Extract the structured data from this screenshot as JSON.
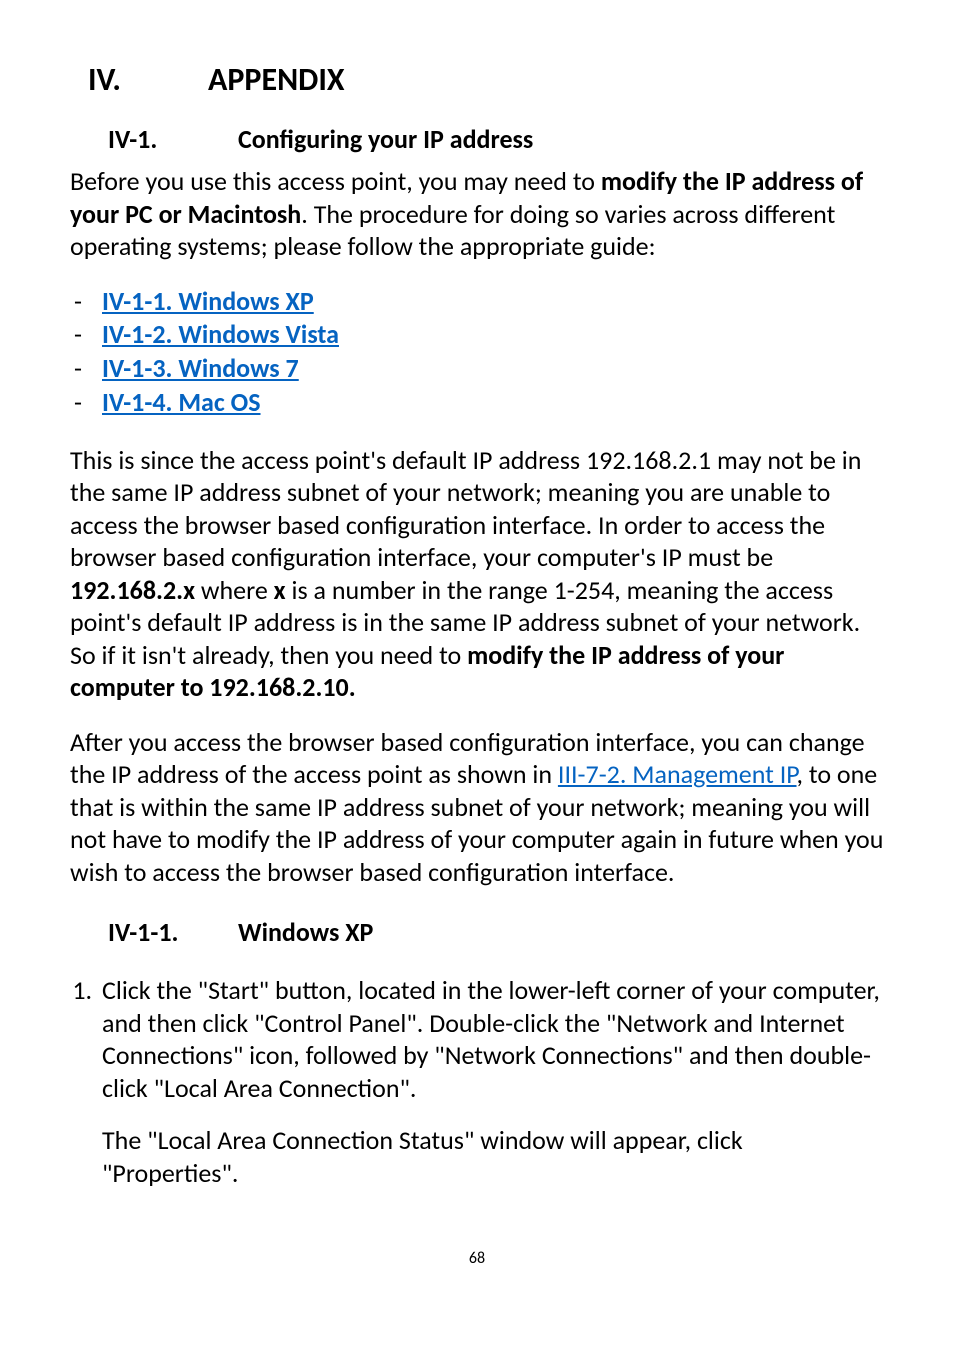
{
  "heading": {
    "roman": "IV.",
    "title": "APPENDIX"
  },
  "section": {
    "num": "IV-1.",
    "title": "Configuring your IP address"
  },
  "intro": {
    "pre": "Before you use this access point, you may need to ",
    "bold1": "modify the IP address of your PC or Macintosh",
    "post": ". The procedure for doing so varies across different operating systems; please follow the appropriate guide:"
  },
  "links": {
    "xp": "IV-1-1.   Windows XP",
    "vista": "IV-1-2.   Windows Vista",
    "win7": "IV-1-3.   Windows 7",
    "mac": "IV-1-4.   Mac OS"
  },
  "para2": {
    "part1": "This is since the access point's default IP address 192.168.2.1 may not be in the same IP address subnet of your network; meaning you are unable to access the browser based configuration interface. In order to access the browser based configuration interface, your computer's IP must be ",
    "bold1": "192.168.2.x",
    "mid1": " where ",
    "bold2": "x",
    "mid2": " is a number in the range 1-254, meaning the access point's default IP address is in the same IP address subnet of your network. So if it isn't already, then you need to ",
    "bold3": "modify the IP address of your computer to 192.168.2.10."
  },
  "para3": {
    "pre": "After you access the browser based configuration interface, you can change the IP address of the access point as shown in ",
    "link": "III-7-2. Management IP",
    "post": ", to one that is within the same IP address subnet of your network; meaning you will not have to modify the IP address of your computer again in future when you wish to access the browser based configuration interface."
  },
  "subsection": {
    "num": "IV-1-1.",
    "title": "Windows XP"
  },
  "step1": "Click the \"Start\" button, located in the lower-left corner of your computer, and then click \"Control Panel\". Double-click the \"Network and Internet Connections\" icon, followed by \"Network Connections\" and then double-click \"Local Area Connection\".",
  "step1b": "The \"Local Area Connection Status\" window will appear, click \"Properties\".",
  "pageNumber": "68"
}
